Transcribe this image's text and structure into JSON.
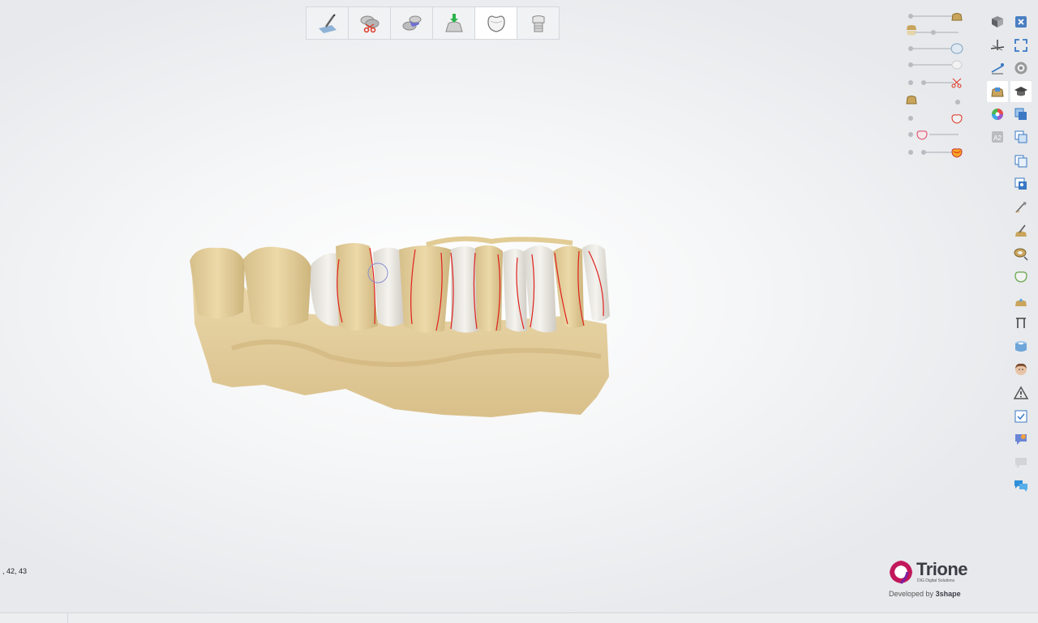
{
  "workflow": {
    "steps": [
      {
        "icon": "scan-edit-icon"
      },
      {
        "icon": "trim-scissors-icon"
      },
      {
        "icon": "align-icon"
      },
      {
        "icon": "die-download-icon",
        "accent": "#2bb34a"
      },
      {
        "icon": "crown-icon",
        "active": true
      },
      {
        "icon": "abutment-icon"
      }
    ]
  },
  "visibility_sliders": [
    {
      "icon": "model-base-icon"
    },
    {
      "icon": "antagonist-icon"
    },
    {
      "icon": "tooth-blue-icon"
    },
    {
      "icon": "tooth-white-icon"
    },
    {
      "icon": "scissors-icon"
    },
    {
      "icon": "gingiva-icon"
    },
    {
      "icon": "crown-red-margin-icon"
    },
    {
      "icon": "tooth-red-icon"
    },
    {
      "icon": "tooth-heatmap-icon"
    }
  ],
  "toolbar_left": [
    "view-cube-icon",
    "axis-icon",
    "measure-icon",
    "model-highlight-icon",
    "color-wheel-icon",
    "a2-shade-icon"
  ],
  "toolbar_right": [
    "close-icon",
    "fullscreen-icon",
    "rotate-icon",
    "graduation-cap-icon",
    "layer-blue-icon",
    "layer-copy-icon",
    "copy-icon",
    "image-icon",
    "spatula-icon",
    "sculpt-icon",
    "ring-icon",
    "crown-outline-icon",
    "wax-icon",
    "ruler-section-icon",
    "cylinder-icon",
    "face-icon",
    "warning-icon",
    "checklist-icon",
    "speech-color-icon",
    "speech-gray-icon",
    "chat-icon"
  ],
  "status": {
    "text": ", 42, 43"
  },
  "logo": {
    "name": "Trione",
    "tagline": "DIG Digital Solutions",
    "developed_by": "Developed by",
    "partner": "3shape",
    "brand_color": "#c2185b"
  },
  "colors": {
    "model": "#e6d2a0",
    "tooth": "#eeeae2",
    "margin_line": "#e0201c"
  }
}
